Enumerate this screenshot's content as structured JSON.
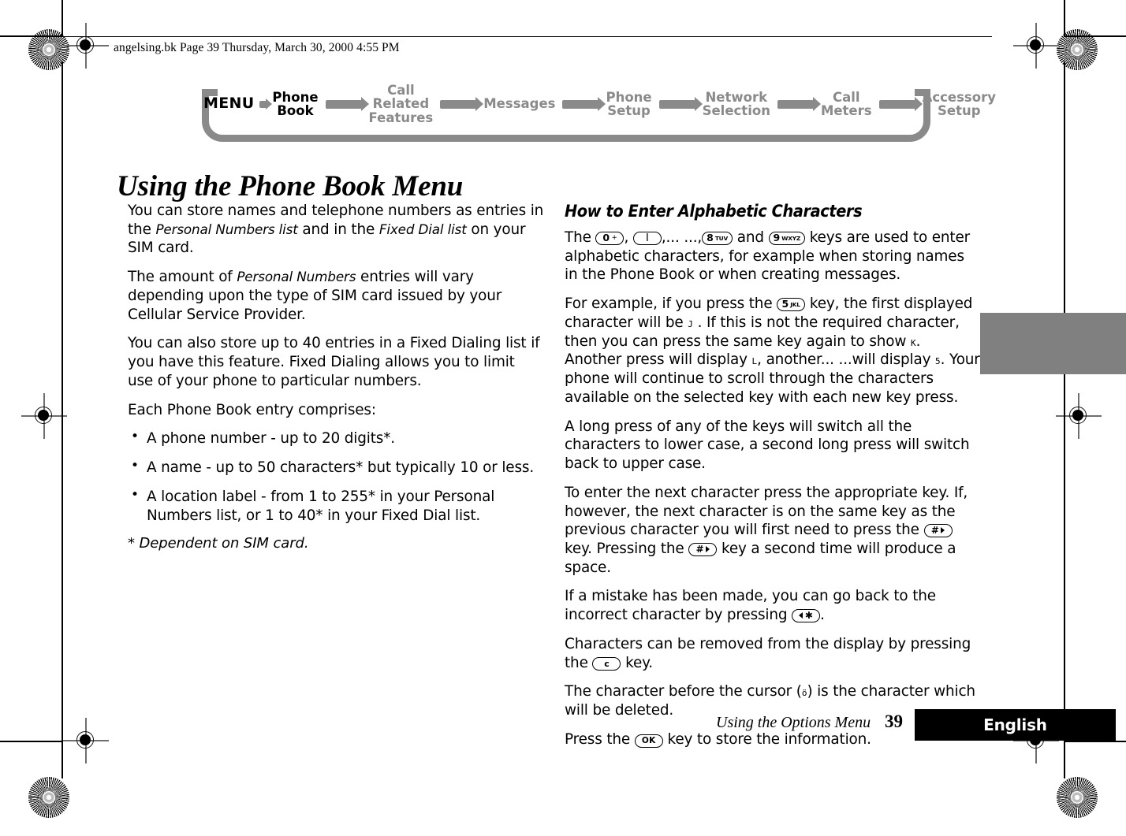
{
  "slug": {
    "text": "angelsing.bk  Page 39  Thursday, March 30, 2000  4:55 PM"
  },
  "ribbon": {
    "menu_label": "MENU",
    "items": [
      {
        "label": "Phone\nBook",
        "active": true
      },
      {
        "label": "Call Related\nFeatures",
        "active": false
      },
      {
        "label": "Messages",
        "active": false
      },
      {
        "label": "Phone\nSetup",
        "active": false
      },
      {
        "label": "Network\nSelection",
        "active": false
      },
      {
        "label": "Call\nMeters",
        "active": false
      },
      {
        "label": "Accessory\nSetup",
        "active": false
      }
    ],
    "colors": {
      "inactive": "#8a8a8a",
      "active": "#000000"
    }
  },
  "title": "Using the Phone Book Menu",
  "left_column": {
    "p1_a": "You can store names and telephone numbers as entries in the ",
    "p1_em1": "Personal Numbers list",
    "p1_b": " and in the ",
    "p1_em2": "Fixed Dial list",
    "p1_c": " on your SIM card.",
    "p2_a": "The amount of ",
    "p2_em1": "Personal Numbers",
    "p2_b": " entries will vary depending upon the type of SIM card issued by your Cellular Service Provider.",
    "p3": "You can also store up to 40 entries in a Fixed Dialing list if you have this feature. Fixed Dialing allows you to limit use of your phone to particular numbers.",
    "p4": "Each Phone Book entry comprises:",
    "bullets": [
      "A phone number - up to 20 digits*.",
      "A name - up to 50 characters* but typically 10 or less.",
      "A location label - from 1 to 255* in your Personal Numbers list, or 1 to 40* in your Fixed Dial list."
    ],
    "footnote_marker": "*",
    "footnote_text": " Dependent on SIM card."
  },
  "right_column": {
    "heading": "How to Enter Alphabetic Characters",
    "p1_a": "The ",
    "p1_b": ", ",
    "p1_c": ",... ...,",
    "p1_d": " and ",
    "p1_e": " keys are used to enter alphabetic characters, for example when storing names in the Phone Book or when creating messages.",
    "p2_a": "For example, if you press the ",
    "p2_b": " key, the first displayed character will be ",
    "p2_lcd1": "J",
    "p2_c": " . If this is not the required character, then you can press the same key again to show ",
    "p2_lcd2": "K",
    "p2_d": ". Another press will display ",
    "p2_lcd3": "L",
    "p2_e": ", another...  ...will display ",
    "p2_lcd4": "5",
    "p2_f": ". Your phone will continue to scroll through the characters available on the selected key with each new key press.",
    "p3": "A long press of any of the keys will switch all the characters to lower case, a second long press will switch back to upper case.",
    "p4_a": "To enter the next character press the appropriate key. If, however, the next character is on the same key as the previous character you will first need to press the ",
    "p4_b": " key. Pressing the ",
    "p4_c": " key a second time will produce a space.",
    "p5_a": "If a mistake has been made, you can go back to the incorrect character by pressing ",
    "p5_b": ".",
    "p6_a": "Characters can be removed from the display by pressing the ",
    "p6_b": " key.",
    "p7_a": "The character before the cursor (",
    "p7_cursor": "ö",
    "p7_b": ") is the character which will be deleted.",
    "p8_a": "Press the ",
    "p8_b": " key to store the information."
  },
  "keys": {
    "k0": {
      "num": "0",
      "sup": "+"
    },
    "k1": {
      "num": "1",
      "glyph": "I"
    },
    "k8": {
      "num": "8",
      "sup": "TUV"
    },
    "k9": {
      "num": "9",
      "sup": "WXYZ"
    },
    "k5": {
      "num": "5",
      "sup": "JKL"
    },
    "hash": {
      "num": "#"
    },
    "star": {
      "num": "✱"
    },
    "clear": {
      "num": "c"
    },
    "ok": {
      "num": "OK"
    }
  },
  "footer": {
    "running_title": "Using the Options Menu",
    "page_number": "39",
    "language": "English"
  }
}
